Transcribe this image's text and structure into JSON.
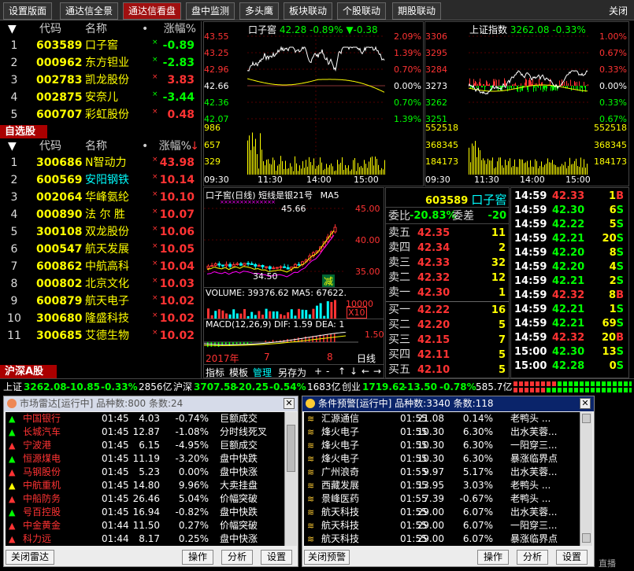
{
  "tabs": [
    "设置版面",
    "通达信全景",
    "通达信看盘",
    "盘中监测",
    "多头鹰",
    "板块联动",
    "个股联动",
    "期股联动"
  ],
  "close_label": "关闭",
  "list1": {
    "headers": [
      "代码",
      "名称",
      "涨幅%"
    ],
    "rows": [
      {
        "i": "1",
        "code": "603589",
        "name": "口子窖",
        "pct": "-0.89",
        "dir": "dn"
      },
      {
        "i": "2",
        "code": "000962",
        "name": "东方钽业",
        "pct": "-2.83",
        "dir": "dn"
      },
      {
        "i": "3",
        "code": "002783",
        "name": "凯龙股份",
        "pct": "3.83",
        "dir": "up"
      },
      {
        "i": "4",
        "code": "002875",
        "name": "安奈儿",
        "pct": "-3.44",
        "dir": "dn"
      },
      {
        "i": "5",
        "code": "600707",
        "name": "彩虹股份",
        "pct": "0.48",
        "dir": "up"
      }
    ]
  },
  "section_self": "自选股",
  "list2": {
    "headers": [
      "代码",
      "名称",
      "涨幅%"
    ],
    "rows": [
      {
        "i": "1",
        "code": "300686",
        "name": "N智动力",
        "pct": "43.98",
        "dir": "up"
      },
      {
        "i": "2",
        "code": "600569",
        "name": "安阳钢铁",
        "pct": "10.14",
        "dir": "up"
      },
      {
        "i": "3",
        "code": "002064",
        "name": "华峰氨纶",
        "pct": "10.10",
        "dir": "up"
      },
      {
        "i": "4",
        "code": "000890",
        "name": "法 尔 胜",
        "pct": "10.07",
        "dir": "up"
      },
      {
        "i": "5",
        "code": "300108",
        "name": "双龙股份",
        "pct": "10.06",
        "dir": "up"
      },
      {
        "i": "6",
        "code": "000547",
        "name": "航天发展",
        "pct": "10.05",
        "dir": "up"
      },
      {
        "i": "7",
        "code": "600862",
        "name": "中航高科",
        "pct": "10.04",
        "dir": "up"
      },
      {
        "i": "8",
        "code": "000802",
        "name": "北京文化",
        "pct": "10.03",
        "dir": "up"
      },
      {
        "i": "9",
        "code": "600879",
        "name": "航天电子",
        "pct": "10.02",
        "dir": "up"
      },
      {
        "i": "10",
        "code": "300680",
        "name": "隆盛科技",
        "pct": "10.02",
        "dir": "up"
      },
      {
        "i": "11",
        "code": "300685",
        "name": "艾德生物",
        "pct": "10.02",
        "dir": "up"
      }
    ]
  },
  "section_hs": "沪深A股",
  "intraday1": {
    "name": "口子窖",
    "price": "42.28",
    "pct": "-0.89%",
    "chg": "▼-0.38",
    "left_axis": [
      "43.55",
      "43.25",
      "42.96",
      "42.66",
      "42.36",
      "42.07",
      "986",
      "657",
      "329"
    ],
    "right_axis": [
      "2.09%",
      "1.39%",
      "0.70%",
      "0.00%",
      "0.70%",
      "1.39%"
    ],
    "times": [
      "09:30",
      "11:30",
      "14:00",
      "15:00"
    ]
  },
  "intraday2": {
    "name": "上证指数",
    "price": "3262.08",
    "pct": "-0.33%",
    "left_axis": [
      "3306",
      "3295",
      "3284",
      "3273",
      "3262",
      "3251",
      "552518",
      "368345",
      "184173"
    ],
    "right_axis": [
      "1.00%",
      "0.67%",
      "0.33%",
      "0.00%",
      "0.33%",
      "0.67%",
      "552518",
      "368345",
      "184173"
    ],
    "times": [
      "09:30",
      "11:30",
      "14:00",
      "15:00"
    ]
  },
  "kline": {
    "title": "口子窖(日线) 短线是银21号",
    "ma": "MA5",
    "axis": [
      "45.00",
      "40.00",
      "35.00"
    ],
    "hi": "45.66",
    "lo": "34.50",
    "sell_mark": "减",
    "vol_label": "VOLUME: 39376.62 MA5: 67622.",
    "vol_axis": "10000",
    "x10": "X10",
    "macd_label": "MACD(12,26,9) DIF: 1.59 DEA: 1",
    "macd_axis": "1.50",
    "date_labels": [
      "2017年",
      "7",
      "8"
    ],
    "period": "日线",
    "tool_tabs": [
      "指标",
      "模板",
      "管理",
      "另存为"
    ],
    "nav": [
      "+",
      "-",
      "↑",
      "↓",
      "←",
      "→"
    ]
  },
  "orderbook": {
    "code": "603589",
    "name": "口子窖",
    "wb_label": "委比",
    "wb": "-20.83%",
    "wc_label": "委差",
    "wc": "-20",
    "asks": [
      {
        "l": "卖五",
        "p": "42.35",
        "v": "11"
      },
      {
        "l": "卖四",
        "p": "42.34",
        "v": "2"
      },
      {
        "l": "卖三",
        "p": "42.33",
        "v": "32"
      },
      {
        "l": "卖二",
        "p": "42.32",
        "v": "12"
      },
      {
        "l": "卖一",
        "p": "42.30",
        "v": "1"
      }
    ],
    "bids": [
      {
        "l": "买一",
        "p": "42.22",
        "v": "16"
      },
      {
        "l": "买二",
        "p": "42.20",
        "v": "5"
      },
      {
        "l": "买三",
        "p": "42.15",
        "v": "7"
      },
      {
        "l": "买四",
        "p": "42.11",
        "v": "5"
      },
      {
        "l": "买五",
        "p": "42.10",
        "v": "5"
      }
    ]
  },
  "ticks": [
    {
      "t": "14:59",
      "p": "42.33",
      "v": "1",
      "s": "B"
    },
    {
      "t": "14:59",
      "p": "42.30",
      "v": "6",
      "s": "S"
    },
    {
      "t": "14:59",
      "p": "42.22",
      "v": "5",
      "s": "S"
    },
    {
      "t": "14:59",
      "p": "42.21",
      "v": "20",
      "s": "S"
    },
    {
      "t": "14:59",
      "p": "42.20",
      "v": "8",
      "s": "S"
    },
    {
      "t": "14:59",
      "p": "42.20",
      "v": "4",
      "s": "S"
    },
    {
      "t": "14:59",
      "p": "42.21",
      "v": "2",
      "s": "S"
    },
    {
      "t": "14:59",
      "p": "42.32",
      "v": "8",
      "s": "B"
    },
    {
      "t": "14:59",
      "p": "42.21",
      "v": "1",
      "s": "S"
    },
    {
      "t": "14:59",
      "p": "42.21",
      "v": "69",
      "s": "S"
    },
    {
      "t": "14:59",
      "p": "42.32",
      "v": "20",
      "s": "B"
    },
    {
      "t": "15:00",
      "p": "42.30",
      "v": "13",
      "s": "S"
    },
    {
      "t": "15:00",
      "p": "42.28",
      "v": "0",
      "s": "S"
    }
  ],
  "status": {
    "sh_label": "上证",
    "sh": "3262.08",
    "sh_chg": "-10.85",
    "sh_pct": "-0.33%",
    "sh_amt": "2856亿",
    "sz_label": "沪深",
    "sz": "3707.58",
    "sz_chg": "-20.25",
    "sz_pct": "-0.54%",
    "sz_amt": "1683亿",
    "cy_label": "创业",
    "cy": "1719.62",
    "cy_chg": "-13.50",
    "cy_pct": "-0.78%",
    "cy_amt": "585.7亿"
  },
  "radar": {
    "title": "市场雷达[运行中] 品种数:800 条数:24",
    "close_btn": "关闭雷达",
    "buttons": [
      "操作",
      "分析",
      "设置"
    ],
    "rows": [
      {
        "n": "中国银行",
        "t": "01:45",
        "p": "4.03",
        "c": "-0.74%",
        "e": "巨额成交",
        "ic": "g"
      },
      {
        "n": "长城汽车",
        "t": "01:45",
        "p": "12.87",
        "c": "-1.08%",
        "e": "分时线死叉",
        "ic": "g"
      },
      {
        "n": "宁波港",
        "t": "01:45",
        "p": "6.15",
        "c": "-4.95%",
        "e": "巨额成交",
        "ic": "r"
      },
      {
        "n": "恒源煤电",
        "t": "01:45",
        "p": "11.19",
        "c": "-3.20%",
        "e": "盘中快跌",
        "ic": "g"
      },
      {
        "n": "马钢股份",
        "t": "01:45",
        "p": "5.23",
        "c": "0.00%",
        "e": "盘中快涨",
        "ic": "r"
      },
      {
        "n": "中航重机",
        "t": "01:45",
        "p": "14.80",
        "c": "9.96%",
        "e": "大卖挂盘",
        "ic": "y"
      },
      {
        "n": "中船防务",
        "t": "01:45",
        "p": "26.46",
        "c": "5.04%",
        "e": "价幅突破",
        "ic": "r"
      },
      {
        "n": "号百控股",
        "t": "01:45",
        "p": "16.94",
        "c": "-0.82%",
        "e": "盘中快跌",
        "ic": "g"
      },
      {
        "n": "中金黄金",
        "t": "01:44",
        "p": "11.50",
        "c": "0.27%",
        "e": "价幅突破",
        "ic": "r"
      },
      {
        "n": "科力远",
        "t": "01:44",
        "p": "8.17",
        "c": "0.25%",
        "e": "盘中快涨",
        "ic": "r"
      }
    ]
  },
  "cond": {
    "title": "条件预警[运行中] 品种数:3340 条数:118",
    "close_btn": "关闭预警",
    "buttons": [
      "操作",
      "分析",
      "设置"
    ],
    "rows": [
      {
        "n": "汇源通信",
        "t": "01:55",
        "p": "21.08",
        "c": "0.14%",
        "e": "老鸭头 ..."
      },
      {
        "n": "烽火电子",
        "t": "01:55",
        "p": "10.30",
        "c": "6.30%",
        "e": "出水芙蓉..."
      },
      {
        "n": "烽火电子",
        "t": "01:55",
        "p": "10.30",
        "c": "6.30%",
        "e": "一阳穿三..."
      },
      {
        "n": "烽火电子",
        "t": "01:55",
        "p": "10.30",
        "c": "6.30%",
        "e": "暴涨临界点"
      },
      {
        "n": "广州浪奇",
        "t": "01:55",
        "p": "9.97",
        "c": "5.17%",
        "e": "出水芙蓉..."
      },
      {
        "n": "西藏发展",
        "t": "01:55",
        "p": "13.95",
        "c": "3.03%",
        "e": "老鸭头 ..."
      },
      {
        "n": "景峰医药",
        "t": "01:55",
        "p": "7.39",
        "c": "-0.67%",
        "e": "老鸭头 ..."
      },
      {
        "n": "航天科技",
        "t": "01:55",
        "p": "29.00",
        "c": "6.07%",
        "e": "出水芙蓉..."
      },
      {
        "n": "航天科技",
        "t": "01:55",
        "p": "29.00",
        "c": "6.07%",
        "e": "一阳穿三..."
      },
      {
        "n": "航天科技",
        "t": "01:55",
        "p": "29.00",
        "c": "6.07%",
        "e": "暴涨临界点"
      }
    ]
  },
  "bottom_right": "直播"
}
